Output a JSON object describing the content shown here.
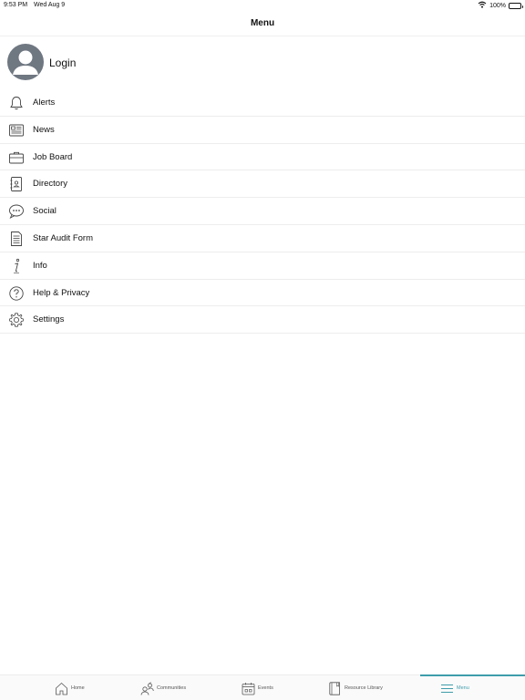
{
  "status_bar": {
    "time": "9:53 PM",
    "date": "Wed Aug 9",
    "battery": "100%"
  },
  "header": {
    "title": "Menu"
  },
  "login": {
    "label": "Login"
  },
  "menu_items": [
    {
      "label": "Alerts",
      "icon": "bell-icon"
    },
    {
      "label": "News",
      "icon": "newspaper-icon"
    },
    {
      "label": "Job Board",
      "icon": "briefcase-icon"
    },
    {
      "label": "Directory",
      "icon": "address-book-icon"
    },
    {
      "label": "Social",
      "icon": "chat-bubble-icon"
    },
    {
      "label": "Star Audit Form",
      "icon": "document-icon"
    },
    {
      "label": "Info",
      "icon": "info-icon"
    },
    {
      "label": "Help & Privacy",
      "icon": "question-circle-icon"
    },
    {
      "label": "Settings",
      "icon": "gear-icon"
    }
  ],
  "tabs": [
    {
      "label": "Home",
      "icon": "home-icon",
      "active": false
    },
    {
      "label": "Communities",
      "icon": "people-icon",
      "active": false
    },
    {
      "label": "Events",
      "icon": "calendar-icon",
      "active": false
    },
    {
      "label": "Resource Library",
      "icon": "book-icon",
      "active": false
    },
    {
      "label": "Menu",
      "icon": "hamburger-icon",
      "active": true
    }
  ],
  "colors": {
    "accent": "#3e9dab",
    "avatar": "#6f7781",
    "separator": "#ededed"
  }
}
